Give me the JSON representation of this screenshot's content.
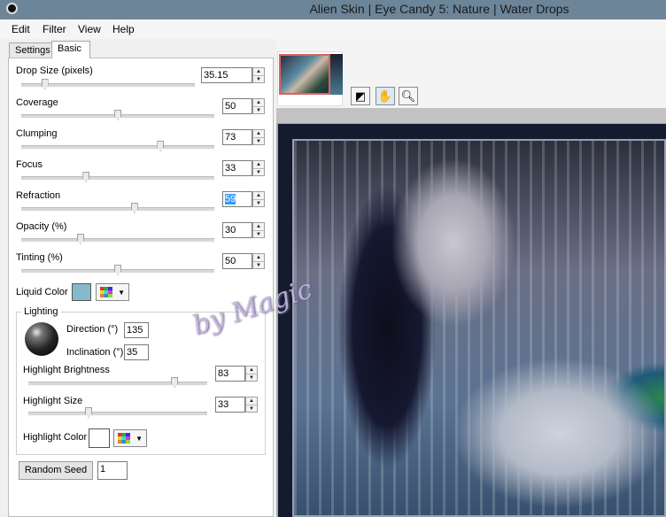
{
  "window": {
    "title": "Alien Skin | Eye Candy 5: Nature | Water Drops"
  },
  "menu": {
    "items": [
      "Edit",
      "Filter",
      "View",
      "Help"
    ]
  },
  "tabs": {
    "settings": "Settings",
    "basic": "Basic"
  },
  "controls": {
    "drop_size": {
      "label": "Drop Size (pixels)",
      "value": "35.15",
      "level": 0.12
    },
    "coverage": {
      "label": "Coverage",
      "value": "50",
      "level": 0.5
    },
    "clumping": {
      "label": "Clumping",
      "value": "73",
      "level": 0.73
    },
    "focus": {
      "label": "Focus",
      "value": "33",
      "level": 0.33
    },
    "refraction": {
      "label": "Refraction",
      "value": "59",
      "level": 0.59
    },
    "opacity": {
      "label": "Opacity (%)",
      "value": "30",
      "level": 0.3
    },
    "tinting": {
      "label": "Tinting (%)",
      "value": "50",
      "level": 0.5
    }
  },
  "liquid_color": {
    "label": "Liquid Color",
    "color": "#87b9c9"
  },
  "lighting": {
    "legend": "Lighting",
    "direction": {
      "label": "Direction (°)",
      "value": "135"
    },
    "inclination": {
      "label": "Inclination (°)",
      "value": "35"
    },
    "highlight_brightness": {
      "label": "Highlight Brightness",
      "value": "83",
      "level": 0.83
    },
    "highlight_size": {
      "label": "Highlight Size",
      "value": "33",
      "level": 0.33
    },
    "highlight_color": {
      "label": "Highlight Color",
      "color": "#ffffff"
    }
  },
  "random_seed": {
    "button_label": "Random Seed",
    "value": "1"
  },
  "toolbar": {
    "tools": [
      "compare-icon",
      "hand-icon",
      "magnifier-icon"
    ]
  },
  "watermark": "by Magic"
}
